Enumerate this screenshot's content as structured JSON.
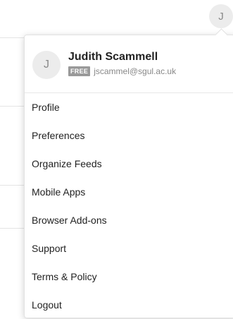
{
  "top_avatar": {
    "initial": "J"
  },
  "profile": {
    "initial": "J",
    "name": "Judith Scammell",
    "badge": "FREE",
    "email": "jscammel@sgul.ac.uk"
  },
  "menu_items": [
    "Profile",
    "Preferences",
    "Organize Feeds",
    "Mobile Apps",
    "Browser Add-ons",
    "Support",
    "Terms & Policy",
    "Logout"
  ]
}
